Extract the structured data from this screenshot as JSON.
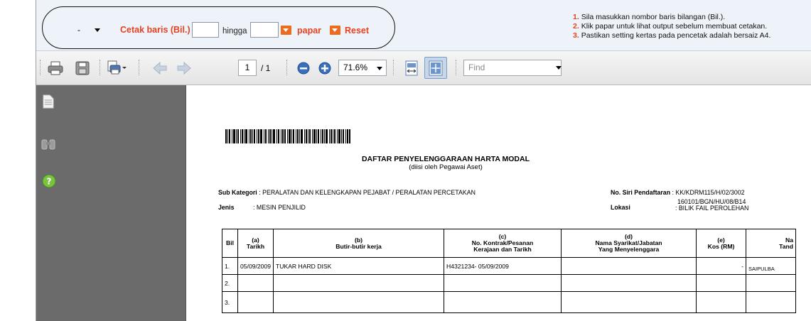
{
  "controls": {
    "bil_select_value": "-",
    "cetak_label": "Cetak baris (Bil.)",
    "from_value": "",
    "hingga_label": "hingga",
    "to_value": "",
    "papar_label": "papar",
    "reset_label": "Reset",
    "notes": [
      {
        "num": "1.",
        "text": "Sila masukkan nombor baris bilangan (Bil.)."
      },
      {
        "num": "2.",
        "text": "Klik papar untuk lihat output sebelum membuat cetakan."
      },
      {
        "num": "3.",
        "text": "Pastikan setting kertas pada pencetak adalah bersaiz A4."
      }
    ]
  },
  "toolbar": {
    "page_current": "1",
    "page_total": "/ 1",
    "zoom": "71.6%",
    "find_placeholder": "Find"
  },
  "report": {
    "title": "DAFTAR PENYELENGGARAAN HARTA MODAL",
    "subtitle": "(diisi oleh Pegawai Aset)",
    "sub_kategori_label": "Sub Kategori",
    "sub_kategori_value": ": PERALATAN DAN KELENGKAPAN PEJABAT / PERALATAN PERCETAKAN",
    "jenis_label": "Jenis",
    "jenis_value": ": MESIN PENJILID",
    "siri_label": "No. Siri Pendaftaran",
    "siri_value": ": KK/KDRM115/H/02/3002",
    "lokasi_label": "Lokasi",
    "lokasi_line1": "160101/BGN/HU/08/B14",
    "lokasi_line2": ": BILIK FAIL PEROLEHAN",
    "headers": {
      "bil": "Bil",
      "a_code": "(a)",
      "a_label": "Tarikh",
      "b_code": "(b)",
      "b_label": "Butir-butir kerja",
      "c_code": "(c)",
      "c_label1": "No. Kontrak/Pesanan",
      "c_label2": "Kerajaan dan Tarikh",
      "d_code": "(d)",
      "d_label1": "Nama Syarikat/Jabatan",
      "d_label2": "Yang Menyelenggara",
      "e_code": "(e)",
      "e_label": "Kos (RM)",
      "f_label1": "Na",
      "f_label2": "Tand"
    },
    "rows": [
      {
        "bil": "1.",
        "tarikh": "05/09/2009",
        "butir": "TUKAR HARD DISK",
        "kontrak": "H4321234- 05/09/2009",
        "syarikat": "",
        "kos": "-",
        "nama": "SAIPULBA"
      },
      {
        "bil": "2.",
        "tarikh": "",
        "butir": "",
        "kontrak": "",
        "syarikat": "",
        "kos": "",
        "nama": ""
      },
      {
        "bil": "3.",
        "tarikh": "",
        "butir": "",
        "kontrak": "",
        "syarikat": "",
        "kos": "",
        "nama": ""
      }
    ]
  },
  "colors": {
    "accent_orange": "#e8411f",
    "button_orange": "#ee6b1e",
    "panel_gray": "#6b6b6b",
    "control_bg": "#eef3f9"
  },
  "icons": [
    "print-icon",
    "save-icon",
    "export-icon",
    "prev-page-icon",
    "next-page-icon",
    "zoom-out-icon",
    "zoom-in-icon",
    "page-width-icon",
    "whole-page-icon",
    "pages-panel-icon",
    "attachments-icon",
    "help-icon"
  ]
}
